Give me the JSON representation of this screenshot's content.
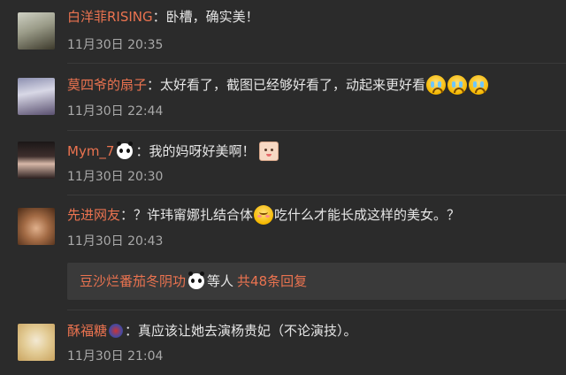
{
  "comments": [
    {
      "username": "白洋菲RISING",
      "text": "：卧槽，确实美！",
      "time": "11月30日 20:35"
    },
    {
      "username": "莫四爷的扇子",
      "text": "：太好看了，截图已经够好看了，动起来更好看",
      "emojis": [
        "crying-emoji",
        "crying-emoji",
        "crying-emoji"
      ],
      "time": "11月30日 22:44"
    },
    {
      "username": "Mym_7",
      "badge": "panda-icon",
      "text": "：我的妈呀好美啊！",
      "sticker": "sticker-icon",
      "time": "11月30日 20:30"
    },
    {
      "username": "先进网友",
      "text_before": "：？许玮甯娜扎结合体",
      "emoji": "shy-emoji",
      "text_after": "吃什么才能长成这样的美女。？",
      "time": "11月30日 20:43"
    },
    {
      "username": "酥福糖",
      "badge": "member-badge-icon",
      "text": "：真应该让她去演杨贵妃（不论演技）。",
      "time": "11月30日 21:04"
    }
  ],
  "reply_summary": {
    "replier": "豆沙烂番茄冬阴功",
    "badge": "panda-icon",
    "middle": "等人",
    "link": "共48条回复"
  },
  "colors": {
    "background": "#2b2b2b",
    "username": "#eb7350",
    "text": "#e6e6e6",
    "time": "#a9a9a9",
    "reply_box": "#3a3a3a"
  }
}
